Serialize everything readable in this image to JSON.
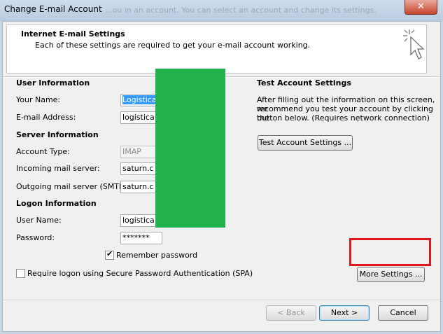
{
  "window": {
    "title": "Change E-mail Account",
    "background_title_text": "...ou in an account. You can select an account and change its settings.",
    "close_glyph": "✕"
  },
  "header": {
    "title": "Internet E-mail Settings",
    "subtitle": "Each of these settings are required to get your e-mail account working."
  },
  "user_info": {
    "heading": "User Information",
    "name_label": "Your Name:",
    "name_value": "Logistica",
    "email_label": "E-mail Address:",
    "email_value": "logistica"
  },
  "server_info": {
    "heading": "Server Information",
    "account_type_label": "Account Type:",
    "account_type_value": "IMAP",
    "incoming_label": "Incoming mail server:",
    "incoming_value": "saturn.c",
    "outgoing_label": "Outgoing mail server (SMTP):",
    "outgoing_value": "saturn.c"
  },
  "logon_info": {
    "heading": "Logon Information",
    "username_label": "User Name:",
    "username_value": "logistica",
    "password_label": "Password:",
    "password_value": "*******",
    "remember_label": "Remember password",
    "remember_checked": true,
    "spa_label": "Require logon using Secure Password Authentication (SPA)",
    "spa_checked": false
  },
  "test_settings": {
    "heading": "Test Account Settings",
    "description_line1": "After filling out the information on this screen, we",
    "description_line2": "recommend you test your account by clicking the",
    "description_line3": "button below. (Requires network connection)",
    "button_label": "Test Account Settings ..."
  },
  "buttons": {
    "more_settings": "More Settings ...",
    "back": "< Back",
    "next": "Next >",
    "cancel": "Cancel"
  },
  "colors": {
    "redaction": "#22b14c",
    "highlight_box": "#e3161e"
  },
  "icons": {
    "header_icon": "cursor-click-icon",
    "checkmark": "✔"
  }
}
